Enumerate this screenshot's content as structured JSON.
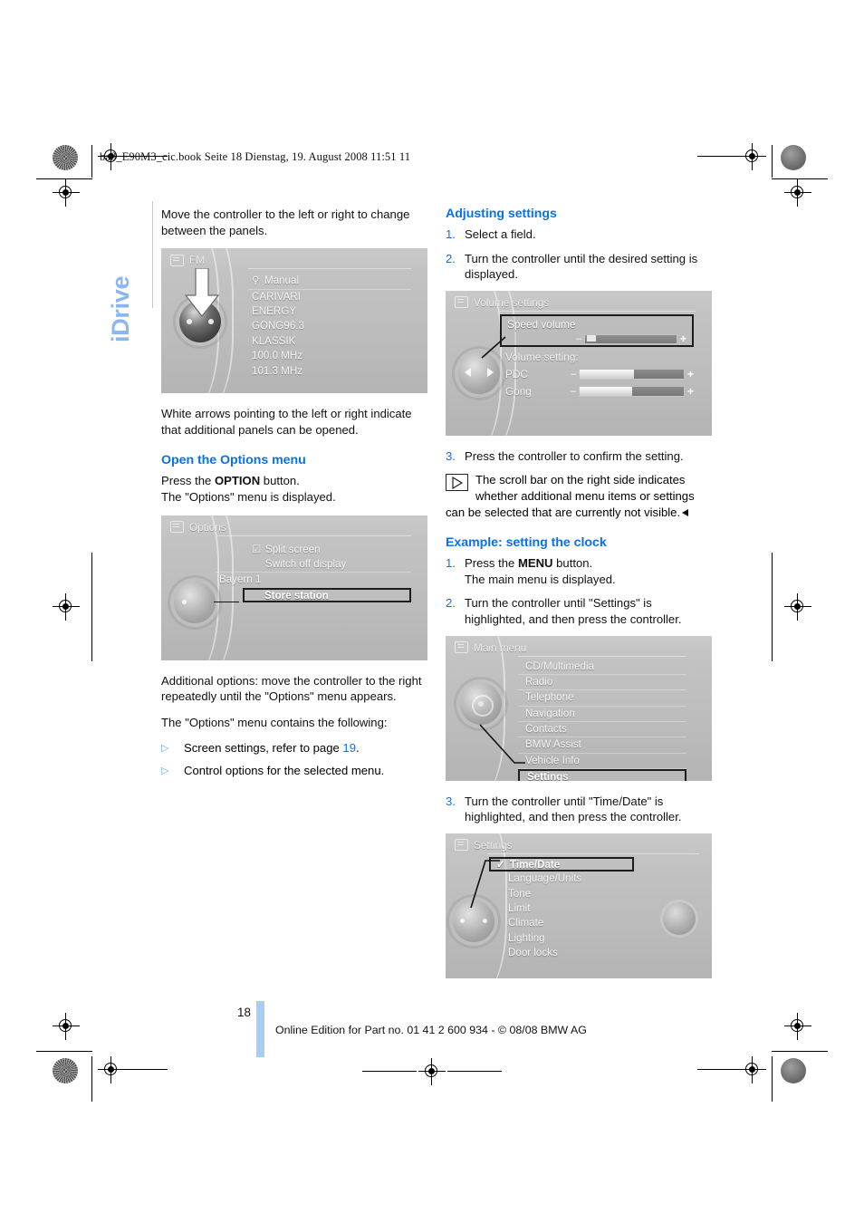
{
  "document": {
    "slug": "ba8_E90M3_cic.book  Seite 18  Dienstag, 19. August 2008  11:51 11",
    "chapter_tab": "iDrive",
    "page_number": "18",
    "footer": "Online Edition for Part no. 01 41 2 600 934 - © 08/08 BMW AG"
  },
  "left_column": {
    "intro_paragraph": "Move the controller to the left or right to change between the panels.",
    "figure_fm": {
      "title": "FM",
      "search_item": "Manual",
      "items": [
        "CARIVARI",
        "ENERGY",
        "GONG96.3",
        "KLASSIK",
        "100.0 MHz",
        "101.3 MHz"
      ]
    },
    "arrows_paragraph": "White arrows pointing to the left or right indicate that additional panels can be opened.",
    "options_heading": "Open the Options menu",
    "options_line1_pre": "Press the ",
    "options_line1_kw": "OPTION",
    "options_line1_post": " button.",
    "options_line2": "The \"Options\" menu is displayed.",
    "figure_options": {
      "title": "Options",
      "items": [
        {
          "label": "Split screen",
          "checked": true
        },
        {
          "label": "Switch off display",
          "checked": false
        },
        {
          "label": "Bayern 1",
          "checked": false,
          "outdent": true
        },
        {
          "label": "Store station",
          "checked": false,
          "highlighted": true
        }
      ]
    },
    "additional_paragraph": "Additional options: move the controller to the right repeatedly until the \"Options\" menu appears.",
    "contains_paragraph": "The \"Options\" menu contains the following:",
    "bullets": [
      {
        "pre": "Screen settings, refer to page ",
        "link": "19",
        "post": "."
      },
      {
        "pre": "Control options for the selected menu.",
        "link": "",
        "post": ""
      }
    ]
  },
  "right_column": {
    "adjusting_heading": "Adjusting settings",
    "adjusting_steps": [
      {
        "num": "1.",
        "text": "Select a field."
      },
      {
        "num": "2.",
        "text": "Turn the controller until the desired setting is displayed."
      }
    ],
    "figure_volume": {
      "title": "Volume settings",
      "highlighted_label": "Speed volume",
      "group_label": "Volume setting:",
      "sliders": [
        {
          "label": "PDC",
          "minus": "–",
          "plus": "+",
          "fill": 52
        },
        {
          "label": "Gong",
          "minus": "–",
          "plus": "+",
          "fill": 50
        }
      ],
      "speed_slider": {
        "minus": "–",
        "plus": "+",
        "fill": 12
      }
    },
    "step3_confirm": {
      "num": "3.",
      "text": "Press the controller to confirm the setting."
    },
    "note_text": "The scroll bar on the right side indicates whether additional menu items or settings can be selected that are currently not visible.",
    "example_heading": "Example: setting the clock",
    "example_steps": [
      {
        "num": "1.",
        "pre": "Press the ",
        "kw": "MENU",
        "post": " button.",
        "line2": "The main menu is displayed."
      },
      {
        "num": "2.",
        "pre": "",
        "kw": "",
        "post": "Turn the controller until \"Settings\" is highlighted, and then press the controller.",
        "line2": ""
      }
    ],
    "figure_main_menu": {
      "title": "Main menu",
      "items": [
        "CD/Multimedia",
        "Radio",
        "Telephone",
        "Navigation",
        "Contacts",
        "BMW Assist",
        "Vehicle Info",
        "Settings"
      ],
      "highlighted": "Settings"
    },
    "step3_timedate": {
      "num": "3.",
      "text": "Turn the controller until \"Time/Date\" is highlighted, and then press the controller."
    },
    "figure_settings": {
      "title": "Settings",
      "items": [
        "Time/Date",
        "Language/Units",
        "Tone",
        "Limit",
        "Climate",
        "Lighting",
        "Door locks"
      ],
      "highlighted": "Time/Date",
      "checked": "Time/Date"
    }
  },
  "colors": {
    "accent_blue": "#0a72e8",
    "tab_blue": "#8ab7f0",
    "page_bar_blue": "#a9cdf5"
  }
}
